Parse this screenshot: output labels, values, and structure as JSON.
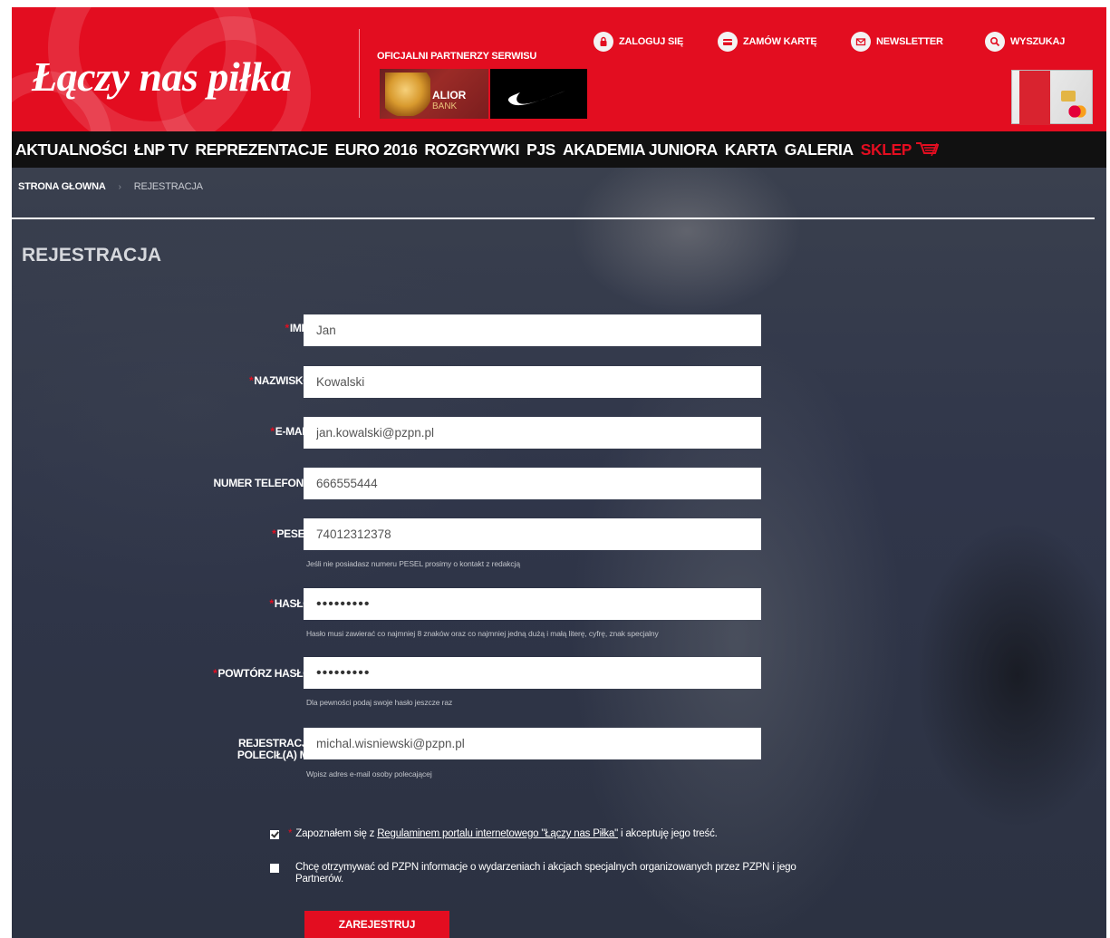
{
  "header": {
    "logo_text": "Łączy nas piłka",
    "partners_label": "OFICJALNI PARTNERZY SERWISU",
    "alior_text": "ALIOR",
    "alior_sub": "BANK",
    "utility": [
      {
        "label": "ZALOGUJ SIĘ",
        "icon": "lock-icon"
      },
      {
        "label": "ZAMÓW KARTĘ",
        "icon": "card-icon"
      },
      {
        "label": "NEWSLETTER",
        "icon": "mail-icon"
      },
      {
        "label": "WYSZUKAJ",
        "icon": "search-icon"
      }
    ],
    "brand_color": "#e30d20"
  },
  "nav": {
    "items": [
      "AKTUALNOŚCI",
      "ŁNP TV",
      "REPREZENTACJE",
      "EURO 2016",
      "ROZGRYWKI",
      "PJS",
      "AKADEMIA JUNIORA",
      "KARTA",
      "GALERIA"
    ],
    "shop": "SKLEP"
  },
  "breadcrumb": {
    "home": "STRONA GŁOWNA",
    "current": "REJESTRACJA"
  },
  "page_title": "REJESTRACJA",
  "form": {
    "first_name": {
      "label": "IMIĘ:",
      "value": "Jan"
    },
    "last_name": {
      "label": "NAZWISKO:",
      "value": "Kowalski"
    },
    "email": {
      "label": "E-MAIL:",
      "value": "jan.kowalski@pzpn.pl"
    },
    "phone": {
      "label": "NUMER TELEFONU:",
      "value": "666555444"
    },
    "pesel": {
      "label": "PESEL:",
      "value": "74012312378",
      "hint": "Jeśli nie posiadasz numeru PESEL prosimy o kontakt z redakcją"
    },
    "password": {
      "label": "HASŁO:",
      "value": "•••••••••",
      "hint": "Hasło musi zawierać co najmniej 8 znaków oraz co najmniej jedną dużą i małą literę, cyfrę, znak specjalny"
    },
    "password_repeat": {
      "label": "POWTÓRZ HASŁO:",
      "value": "•••••••••",
      "hint": "Dla pewności podaj swoje hasło jeszcze raz"
    },
    "referral": {
      "label_line1": "REJESTRACJĘ",
      "label_line2": "POLECIŁ(A) MI:",
      "value": "michal.wisniewski@pzpn.pl",
      "hint": "Wpisz adres e-mail osoby polecającej"
    },
    "consent_terms": {
      "before": "Zapoznałem się z ",
      "link": "Regulaminem portalu internetowego \"Łączy nas Piłka\"",
      "after": " i akceptuję jego treść.",
      "checked": true
    },
    "consent_marketing": {
      "line1": "Chcę otrzymywać od PZPN informacje o wydarzeniach i akcjach specjalnych organizowanych przez PZPN i jego",
      "line2": "Partnerów.",
      "checked": false
    },
    "submit_label": "ZAREJESTRUJ"
  }
}
